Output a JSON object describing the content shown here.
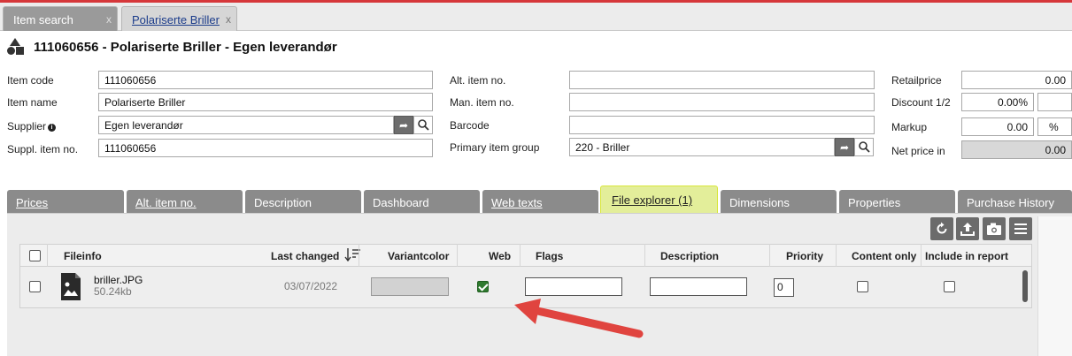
{
  "tabs": [
    {
      "label": "Item search",
      "close": "x"
    },
    {
      "label": "Polariserte Briller",
      "close": "x"
    }
  ],
  "header": {
    "title": "111060656 - Polariserte Briller - Egen leverandør"
  },
  "form": {
    "item_code": {
      "label": "Item code",
      "value": "111060656"
    },
    "item_name": {
      "label": "Item name",
      "value": "Polariserte Briller"
    },
    "supplier": {
      "label": "Supplier",
      "value": "Egen leverandør"
    },
    "suppl_item_no": {
      "label": "Suppl. item no.",
      "value": "111060656"
    },
    "alt_item_no": {
      "label": "Alt. item no.",
      "value": ""
    },
    "man_item_no": {
      "label": "Man. item no.",
      "value": ""
    },
    "barcode": {
      "label": "Barcode",
      "value": ""
    },
    "primary_item_group": {
      "label": "Primary item group",
      "value": "220 - Briller"
    },
    "retailprice": {
      "label": "Retailprice",
      "value": "0.00"
    },
    "discount": {
      "label": "Discount 1/2",
      "value": "0.00%"
    },
    "markup": {
      "label": "Markup",
      "value": "0.00",
      "unit": "%"
    },
    "net_price_in": {
      "label": "Net price in",
      "value": "0.00"
    }
  },
  "section_tabs": [
    {
      "label": "Prices"
    },
    {
      "label": "Alt. item no."
    },
    {
      "label": "Description"
    },
    {
      "label": "Dashboard"
    },
    {
      "label": "Web texts"
    },
    {
      "label": "File explorer (1)"
    },
    {
      "label": "Dimensions"
    },
    {
      "label": "Properties"
    },
    {
      "label": "Purchase History"
    }
  ],
  "toolbar": {
    "icons": [
      "refresh-icon",
      "upload-icon",
      "camera-icon",
      "menu-icon"
    ]
  },
  "grid": {
    "columns": [
      "Fileinfo",
      "Last changed",
      "Variantcolor",
      "Web",
      "Flags",
      "Description",
      "Priority",
      "Content only",
      "Include in report"
    ],
    "rows": [
      {
        "filename": "briller.JPG",
        "size": "50.24kb",
        "last_changed": "03/07/2022",
        "web": true,
        "flags": "",
        "description": "",
        "priority": "0",
        "content_only": false,
        "include_in_report": false
      }
    ]
  },
  "colors": {
    "highlight": "#d6e23a",
    "arrow": "#e0443f",
    "accent_line": "#d6373a"
  }
}
